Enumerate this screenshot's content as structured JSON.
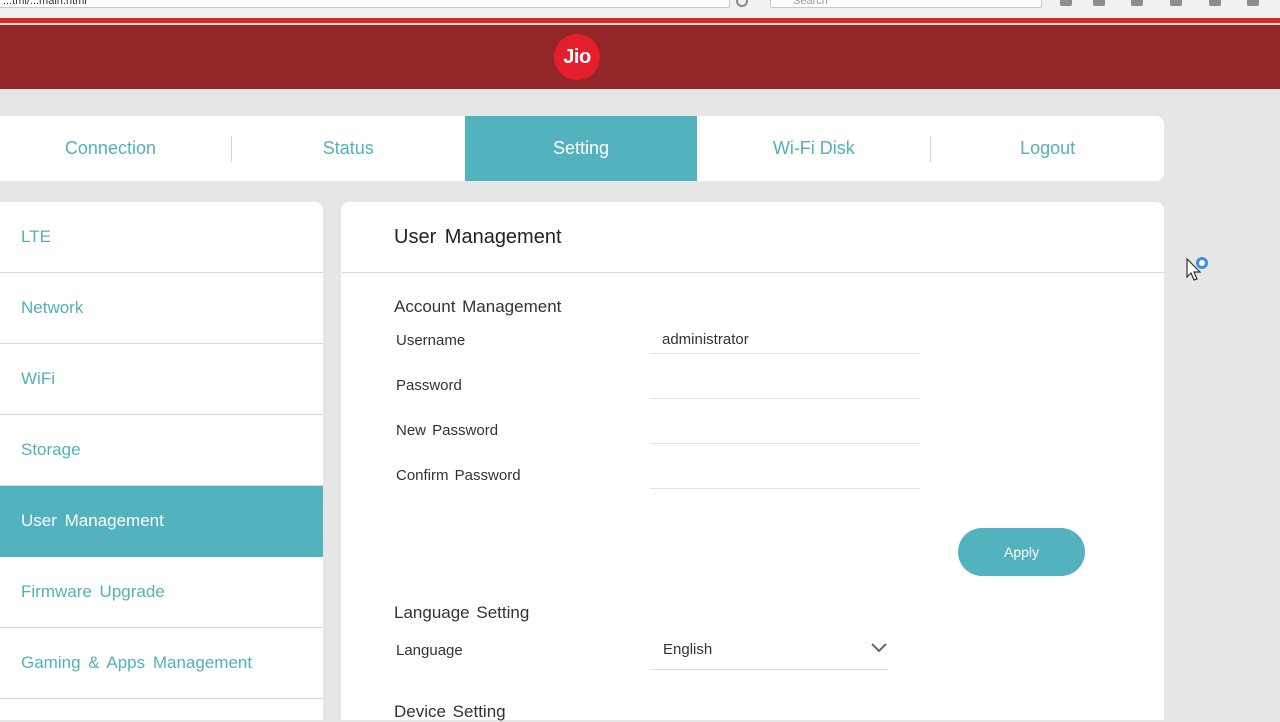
{
  "browser": {
    "url": "...tml/...main.html",
    "search_placeholder": "Search"
  },
  "brand": {
    "logo_text": "Jio"
  },
  "topnav": {
    "tabs": [
      {
        "label": "Connection"
      },
      {
        "label": "Status"
      },
      {
        "label": "Setting"
      },
      {
        "label": "Wi-Fi Disk"
      },
      {
        "label": "Logout"
      }
    ],
    "active": "Setting"
  },
  "sidebar": {
    "items": [
      {
        "label": "LTE"
      },
      {
        "label": "Network"
      },
      {
        "label": "WiFi"
      },
      {
        "label": "Storage"
      },
      {
        "label": "User Management"
      },
      {
        "label": "Firmware Upgrade"
      },
      {
        "label": "Gaming & Apps Management"
      }
    ],
    "active": "User Management"
  },
  "panel": {
    "title": "User Management",
    "account_section": "Account Management",
    "fields": {
      "username": {
        "label": "Username",
        "value": "administrator"
      },
      "password": {
        "label": "Password",
        "value": ""
      },
      "new_password": {
        "label": "New Password",
        "value": ""
      },
      "confirm_password": {
        "label": "Confirm Password",
        "value": ""
      }
    },
    "apply_label": "Apply",
    "language_section": "Language Setting",
    "language": {
      "label": "Language",
      "value": "English"
    },
    "device_section": "Device Setting"
  },
  "colors": {
    "header_red": "#932629",
    "accent_teal": "#52b2be",
    "logo_red": "#e41e2a"
  }
}
